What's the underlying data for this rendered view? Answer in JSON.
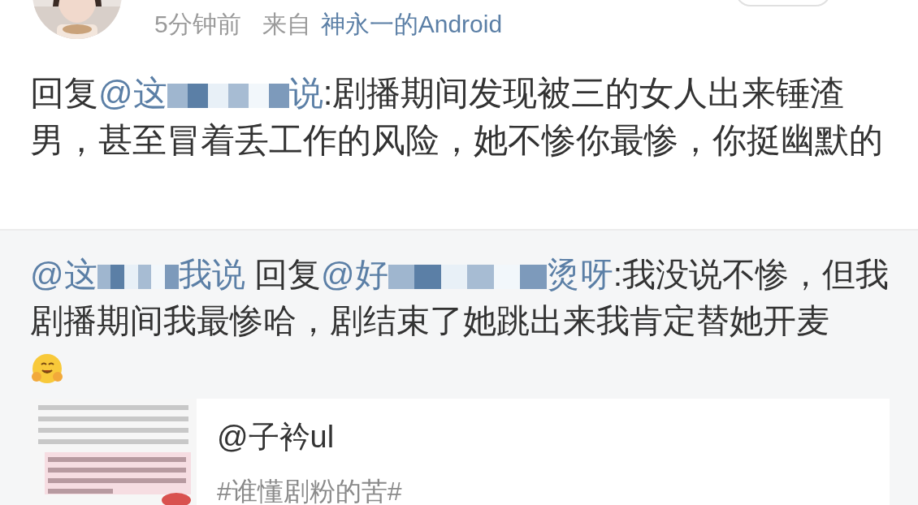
{
  "post": {
    "time": "5分钟前",
    "source_prefix": "来自",
    "source": "神永一的Android"
  },
  "comment": [
    {
      "kind": "text",
      "text": "回复"
    },
    {
      "kind": "mention",
      "text": "@这"
    },
    {
      "kind": "redacted"
    },
    {
      "kind": "mention",
      "text": "说"
    },
    {
      "kind": "text",
      "text": ":剧播期间发现被三的女人出来锤渣男，甚至冒着丢工作的风险，她不惨你最惨，你挺幽默的"
    }
  ],
  "reply": {
    "segments": [
      {
        "kind": "mention",
        "text": "@这"
      },
      {
        "kind": "redacted"
      },
      {
        "kind": "mention",
        "text": "我说"
      },
      {
        "kind": "text",
        "text": " 回复"
      },
      {
        "kind": "mention",
        "text": "@好"
      },
      {
        "kind": "redacted"
      },
      {
        "kind": "mention",
        "text": "烫呀"
      },
      {
        "kind": "text",
        "text": ":我没说不惨，但我剧播期间我最惨哈，剧结束了她跳出来我肯定替她开麦"
      },
      {
        "kind": "emoji"
      }
    ],
    "card": {
      "title": "@子衿ul",
      "hashtag": "#谁懂剧粉的苦#"
    }
  }
}
